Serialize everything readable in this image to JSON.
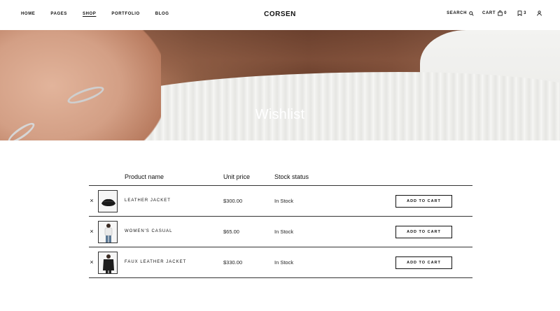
{
  "header": {
    "nav": [
      {
        "label": "HOME",
        "active": false
      },
      {
        "label": "PAGES",
        "active": false
      },
      {
        "label": "SHOP",
        "active": true
      },
      {
        "label": "PORTFOLIO",
        "active": false
      },
      {
        "label": "BLOG",
        "active": false
      }
    ],
    "logo": "CORSEN",
    "search_label": "SEARCH",
    "cart_label": "CART",
    "cart_count": "0",
    "wishlist_count": "3"
  },
  "hero": {
    "title": "Wishlist"
  },
  "table": {
    "headers": {
      "product": "Product name",
      "price": "Unit price",
      "stock": "Stock status"
    },
    "remove_symbol": "×",
    "rows": [
      {
        "name": "LEATHER JACKET",
        "price": "$300.00",
        "stock": "In Stock",
        "button": "ADD TO CART"
      },
      {
        "name": "WOMEN'S CASUAL",
        "price": "$65.00",
        "stock": "In Stock",
        "button": "ADD TO CART"
      },
      {
        "name": "FAUX LEATHER JACKET",
        "price": "$330.00",
        "stock": "In Stock",
        "button": "ADD TO CART"
      }
    ]
  }
}
